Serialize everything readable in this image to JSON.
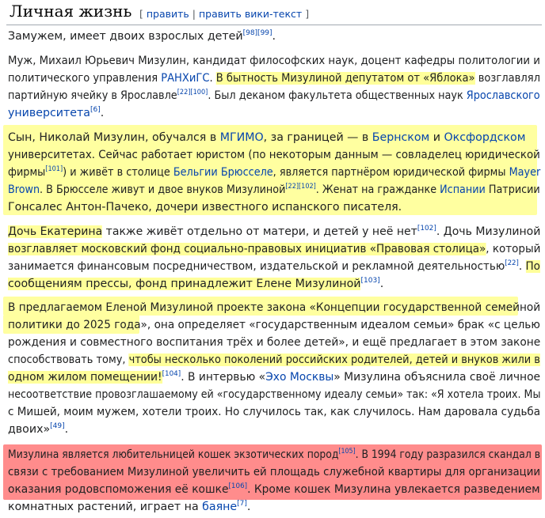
{
  "heading": {
    "title": "Личная жизнь",
    "bracket_open": "[",
    "edit": "править",
    "separator": "|",
    "edit_source": "править вики-текст",
    "bracket_close": "]"
  },
  "p1": {
    "l1": {
      "t": "Замужем, имеет двоих взрослых детей",
      "r": "[98][99]",
      "e": "."
    }
  },
  "p2": {
    "l1": "Муж, Михаил Юрьевич Мизулин, кандидат философских наук, доцент кафедры политологии и",
    "l2": {
      "a": "политического управления ",
      "link": "РАНХиГС",
      "b": ".",
      "hl": "В бытность Мизулиной депутатом от «Яблока»",
      "c": " возглавлял"
    },
    "l3": {
      "a": "партийную ячейку в Ярославле",
      "r": "[22][100]",
      "b": ". Был деканом факультета общественных наук ",
      "link": "Ярославского"
    },
    "l4": {
      "link": "университета",
      "r": "[6]",
      "e": "."
    }
  },
  "p3": {
    "l1": {
      "a": "Сын, Николай Мизулин, обучался в ",
      "link1": "МГИМО",
      "b": ", за границей — в ",
      "link2": "Бернском",
      "c": " и ",
      "link3": "Оксфордском"
    },
    "l2": "университетах. Сейчас работает юристом (по некоторым данным — совладелец юридической",
    "l3": {
      "a": "фирмы",
      "r": "[101]",
      "b": ") и живёт в столице ",
      "link1": "Бельгии",
      "sp": " ",
      "link2": "Брюсселе",
      "c": ", является партнёром юридической фирмы ",
      "link3": "Mayer"
    },
    "l4": {
      "link1": "Brown",
      "a": ". В Брюсселе живут и двое внуков Мизулиной",
      "r": "[22][102]",
      "b": ". Женат на гражданке ",
      "link2": "Испании",
      "c": " Патрисии"
    },
    "l5": "Гонсалес Антон-Пачеко, дочери известного испанского писателя."
  },
  "p4": {
    "l1": {
      "hl": "Дочь Екатерина",
      "a": " также живёт отдельно от матери, и детей у неё нет",
      "r": "[102]",
      "b": ". Дочь Мизулиной"
    },
    "l2": {
      "hl": "возглавляет московский фонд социально-правовых инициатив «Правовая столица»",
      "a": ", который"
    },
    "l3": {
      "a": "занимается финансовым посредничеством, издательской и рекламной деятельностью",
      "r": "[22]",
      "b": ".",
      "hl": "По"
    },
    "l4": {
      "hl": "сообщениям прессы, фонд принадлежит Елене Мизулиной",
      "r": "[103]",
      "e": "."
    }
  },
  "p5": {
    "l1": "В предлагаемом Еленой Мизулиной проекте закона «Концепции государственной семейной",
    "l2": {
      "hl": "политики до 2025 года»",
      "a": ", она определяет «государственным идеалом семьи» брак «с целью"
    },
    "l3": "рождения и совместного воспитания трёх и более детей», и ещё предлагает в этом законе",
    "l4": {
      "a": "способствовать тому, ",
      "hl": "чтобы несколько поколений российских родителей, детей и внуков жили в"
    },
    "l5": {
      "hl": "одном жилом помещении!",
      "r": "[104]",
      "a": ". В интервью «",
      "link": "Эхо Москвы",
      "b": "» Мизулина объяснила своё личное"
    },
    "l6": "несоответствие провозглашаемому ей «государственному идеалу семьи» так: «Я хотела троих. Мы",
    "l7": "с Мишей, моим мужем, хотели троих. Но случилось так, как случилось. Нам даровала судьба",
    "l8": {
      "a": "двоих»",
      "r": "[49]",
      "e": "."
    }
  },
  "p6": {
    "l1": {
      "a": "Мизулина является любительницей кошек экзотических пород",
      "r": "[105]",
      "b": ". В 1994 году разразился скандал в"
    },
    "l2": "связи с требованием Мизулиной увеличить ей площадь служебной квартиры для организации",
    "l3": {
      "a": "оказания родовспоможения её кошке",
      "r": "[106]",
      "b": ". Кроме кошек Мизулина увлекается разведением"
    },
    "l4": {
      "a": "комнатных растений, играет на ",
      "link": "баяне",
      "r": "[7]",
      "e": "."
    }
  },
  "colors": {
    "highlight_yellow": "#ffff9a",
    "highlight_red": "#ff8c8c",
    "link": "#0645ad"
  }
}
